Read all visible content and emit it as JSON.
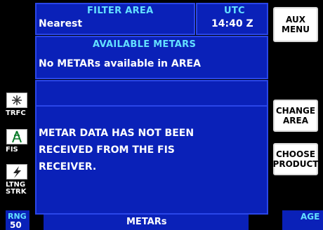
{
  "header": {
    "filter_label": "FILTER AREA",
    "filter_value": "Nearest",
    "utc_label": "UTC",
    "utc_value": "14:40 Z"
  },
  "available": {
    "label": "AVAILABLE METARS",
    "value": "No METARs available in AREA"
  },
  "message": {
    "line1": "METAR DATA HAS NOT BEEN",
    "line2": "RECEIVED FROM THE FIS",
    "line3": "RECEIVER."
  },
  "softkeys": {
    "aux_line1": "AUX",
    "aux_line2": "MENU",
    "change_line1": "CHANGE",
    "change_line2": "AREA",
    "choose_line1": "CHOOSE",
    "choose_line2": "PRODUCT"
  },
  "sidebar": {
    "trfc": "TRFC",
    "fis": "FIS",
    "ltng_line1": "LTNG",
    "ltng_line2": "STRK"
  },
  "bottom": {
    "rng_label": "RNG",
    "rng_value": "50",
    "page_title": "METARs",
    "age_label": "AGE"
  },
  "colors": {
    "panel_blue": "#0a21b8",
    "border_blue": "#2a46e8",
    "label_cyan": "#63e0ff"
  }
}
